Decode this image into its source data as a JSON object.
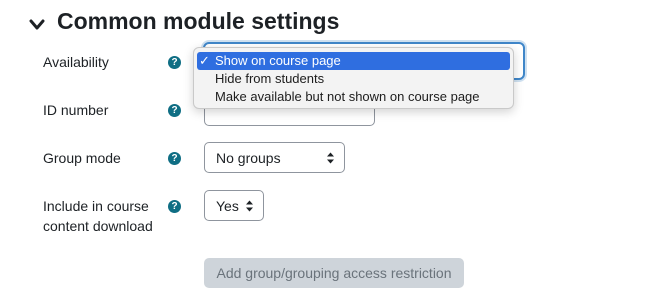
{
  "section": {
    "title": "Common module settings",
    "icon": "chevron-down-icon"
  },
  "fields": {
    "availability": {
      "label": "Availability",
      "options": [
        "Show on course page",
        "Hide from students",
        "Make available but not shown on course page"
      ],
      "selected": "Show on course page"
    },
    "id_number": {
      "label": "ID number",
      "value": ""
    },
    "group_mode": {
      "label": "Group mode",
      "value": "No groups"
    },
    "include_download": {
      "label_line1": "Include in course",
      "label_line2": "content download",
      "value": "Yes"
    }
  },
  "restrictions": {
    "button_label": "Add group/grouping access restriction"
  },
  "colors": {
    "accent": "#2f6ee0",
    "help": "#0f6e84",
    "focus": "#3f86c9"
  }
}
